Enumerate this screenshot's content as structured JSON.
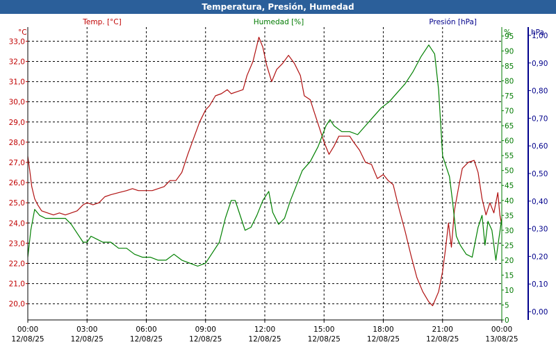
{
  "window_title": "Temperatura, Presión, Humedad",
  "chart_data": {
    "type": "line",
    "title": "Temperatura, Presión, Humedad",
    "grid": true,
    "x_labels": [
      {
        "time": "00:00",
        "date": "12/08/25"
      },
      {
        "time": "03:00",
        "date": "12/08/25"
      },
      {
        "time": "06:00",
        "date": "12/08/25"
      },
      {
        "time": "09:00",
        "date": "12/08/25"
      },
      {
        "time": "12:00",
        "date": "12/08/25"
      },
      {
        "time": "15:00",
        "date": "12/08/25"
      },
      {
        "time": "18:00",
        "date": "12/08/25"
      },
      {
        "time": "21:00",
        "date": "12/08/25"
      },
      {
        "time": "00:00",
        "date": "13/08/25"
      }
    ],
    "x_range_hours": [
      0,
      24
    ],
    "axes": {
      "temperature": {
        "label": "Temp. [°C]",
        "unit": "°C",
        "range": [
          19.2,
          33.7
        ],
        "ticks": [
          "20,0",
          "21,0",
          "22,0",
          "23,0",
          "24,0",
          "25,0",
          "26,0",
          "27,0",
          "28,0",
          "29,0",
          "30,0",
          "31,0",
          "32,0",
          "33,0"
        ],
        "tick_values": [
          20,
          21,
          22,
          23,
          24,
          25,
          26,
          27,
          28,
          29,
          30,
          31,
          32,
          33
        ],
        "color": "#c00000"
      },
      "humidity": {
        "label": "Humedad [%]",
        "unit": "%",
        "range": [
          0,
          98
        ],
        "ticks": [
          "0",
          "5",
          "10",
          "15",
          "20",
          "25",
          "30",
          "35",
          "40",
          "45",
          "50",
          "55",
          "60",
          "65",
          "70",
          "75",
          "80",
          "85",
          "90",
          "95"
        ],
        "tick_values": [
          0,
          5,
          10,
          15,
          20,
          25,
          30,
          35,
          40,
          45,
          50,
          55,
          60,
          65,
          70,
          75,
          80,
          85,
          90,
          95
        ],
        "color": "#007a00"
      },
      "pressure": {
        "label": "Presión [hPa]",
        "unit": "hPa",
        "range": [
          -0.03,
          1.03
        ],
        "ticks": [
          "0,00",
          "0,10",
          "0,20",
          "0,30",
          "0,40",
          "0,50",
          "0,60",
          "0,70",
          "0,80",
          "0,90",
          "1,00"
        ],
        "tick_values": [
          0,
          0.1,
          0.2,
          0.3,
          0.4,
          0.5,
          0.6,
          0.7,
          0.8,
          0.9,
          1.0
        ],
        "color": "#00008b"
      }
    },
    "series": [
      {
        "name": "Temp. [°C]",
        "axis": "temperature",
        "color": "#b01010",
        "points": [
          [
            0,
            27.3
          ],
          [
            0.1,
            26.6
          ],
          [
            0.2,
            25.8
          ],
          [
            0.35,
            25.2
          ],
          [
            0.5,
            24.9
          ],
          [
            0.7,
            24.6
          ],
          [
            1.0,
            24.5
          ],
          [
            1.3,
            24.4
          ],
          [
            1.6,
            24.5
          ],
          [
            1.9,
            24.4
          ],
          [
            2.2,
            24.5
          ],
          [
            2.5,
            24.6
          ],
          [
            2.8,
            24.9
          ],
          [
            3.0,
            25.0
          ],
          [
            3.3,
            24.9
          ],
          [
            3.6,
            25.0
          ],
          [
            3.9,
            25.3
          ],
          [
            4.2,
            25.4
          ],
          [
            4.6,
            25.5
          ],
          [
            5.0,
            25.6
          ],
          [
            5.3,
            25.7
          ],
          [
            5.6,
            25.6
          ],
          [
            6.0,
            25.6
          ],
          [
            6.3,
            25.6
          ],
          [
            6.6,
            25.7
          ],
          [
            6.9,
            25.8
          ],
          [
            7.2,
            26.1
          ],
          [
            7.5,
            26.1
          ],
          [
            7.8,
            26.5
          ],
          [
            8.1,
            27.4
          ],
          [
            8.4,
            28.2
          ],
          [
            8.7,
            29.0
          ],
          [
            9.0,
            29.6
          ],
          [
            9.2,
            29.8
          ],
          [
            9.5,
            30.3
          ],
          [
            9.8,
            30.4
          ],
          [
            10.1,
            30.6
          ],
          [
            10.3,
            30.4
          ],
          [
            10.6,
            30.5
          ],
          [
            10.9,
            30.6
          ],
          [
            11.1,
            31.3
          ],
          [
            11.4,
            32.0
          ],
          [
            11.7,
            33.2
          ],
          [
            11.9,
            32.7
          ],
          [
            12.1,
            31.8
          ],
          [
            12.35,
            31.0
          ],
          [
            12.6,
            31.6
          ],
          [
            12.9,
            31.9
          ],
          [
            13.2,
            32.3
          ],
          [
            13.5,
            31.9
          ],
          [
            13.8,
            31.3
          ],
          [
            14.0,
            30.3
          ],
          [
            14.3,
            30.1
          ],
          [
            14.5,
            29.5
          ],
          [
            14.8,
            28.6
          ],
          [
            15.0,
            28.0
          ],
          [
            15.25,
            27.4
          ],
          [
            15.5,
            27.8
          ],
          [
            15.75,
            28.3
          ],
          [
            16.0,
            28.3
          ],
          [
            16.3,
            28.3
          ],
          [
            16.5,
            28.0
          ],
          [
            16.8,
            27.6
          ],
          [
            17.1,
            27.0
          ],
          [
            17.4,
            26.9
          ],
          [
            17.7,
            26.2
          ],
          [
            18.0,
            26.4
          ],
          [
            18.25,
            26.1
          ],
          [
            18.5,
            25.9
          ],
          [
            18.8,
            24.7
          ],
          [
            19.1,
            23.6
          ],
          [
            19.4,
            22.4
          ],
          [
            19.7,
            21.3
          ],
          [
            20.0,
            20.6
          ],
          [
            20.3,
            20.1
          ],
          [
            20.5,
            19.9
          ],
          [
            20.8,
            20.6
          ],
          [
            21.0,
            21.6
          ],
          [
            21.15,
            22.7
          ],
          [
            21.3,
            24.0
          ],
          [
            21.45,
            22.8
          ],
          [
            21.6,
            24.6
          ],
          [
            21.8,
            25.7
          ],
          [
            22.0,
            26.7
          ],
          [
            22.3,
            27.0
          ],
          [
            22.6,
            27.1
          ],
          [
            22.8,
            26.5
          ],
          [
            23.0,
            25.2
          ],
          [
            23.2,
            24.4
          ],
          [
            23.4,
            25.0
          ],
          [
            23.6,
            24.5
          ],
          [
            23.8,
            25.5
          ],
          [
            23.9,
            24.4
          ],
          [
            24.0,
            23.9
          ]
        ]
      },
      {
        "name": "Humedad [%]",
        "axis": "humidity",
        "color": "#008000",
        "points": [
          [
            0,
            21
          ],
          [
            0.15,
            30
          ],
          [
            0.35,
            37
          ],
          [
            0.6,
            35
          ],
          [
            0.9,
            34
          ],
          [
            1.2,
            34
          ],
          [
            1.5,
            34
          ],
          [
            1.9,
            34
          ],
          [
            2.2,
            32
          ],
          [
            2.5,
            29
          ],
          [
            2.8,
            26
          ],
          [
            3.0,
            26
          ],
          [
            3.2,
            28
          ],
          [
            3.5,
            27
          ],
          [
            3.8,
            26
          ],
          [
            4.2,
            26
          ],
          [
            4.6,
            24
          ],
          [
            5.0,
            24
          ],
          [
            5.4,
            22
          ],
          [
            5.8,
            21
          ],
          [
            6.2,
            21
          ],
          [
            6.6,
            20
          ],
          [
            7.0,
            20
          ],
          [
            7.4,
            22
          ],
          [
            7.8,
            20
          ],
          [
            8.2,
            19
          ],
          [
            8.6,
            18
          ],
          [
            9.0,
            19
          ],
          [
            9.3,
            22
          ],
          [
            9.7,
            26
          ],
          [
            10.0,
            34
          ],
          [
            10.3,
            40
          ],
          [
            10.5,
            40
          ],
          [
            10.7,
            36
          ],
          [
            11.0,
            30
          ],
          [
            11.3,
            31
          ],
          [
            11.6,
            35
          ],
          [
            11.9,
            40
          ],
          [
            12.2,
            43
          ],
          [
            12.4,
            36
          ],
          [
            12.7,
            32
          ],
          [
            13.0,
            34
          ],
          [
            13.3,
            40
          ],
          [
            13.6,
            45
          ],
          [
            13.9,
            50
          ],
          [
            14.3,
            53
          ],
          [
            14.7,
            58
          ],
          [
            15.1,
            65
          ],
          [
            15.3,
            67
          ],
          [
            15.5,
            65
          ],
          [
            15.9,
            63
          ],
          [
            16.3,
            63
          ],
          [
            16.7,
            62
          ],
          [
            17.1,
            65
          ],
          [
            17.5,
            68
          ],
          [
            17.9,
            71
          ],
          [
            18.3,
            73
          ],
          [
            18.7,
            76
          ],
          [
            19.1,
            79
          ],
          [
            19.5,
            83
          ],
          [
            19.9,
            88
          ],
          [
            20.3,
            92
          ],
          [
            20.6,
            89
          ],
          [
            20.8,
            77
          ],
          [
            21.0,
            55
          ],
          [
            21.2,
            51
          ],
          [
            21.35,
            48
          ],
          [
            21.5,
            40
          ],
          [
            21.7,
            28
          ],
          [
            21.9,
            25
          ],
          [
            22.2,
            22
          ],
          [
            22.5,
            21
          ],
          [
            22.8,
            31
          ],
          [
            23.0,
            35
          ],
          [
            23.15,
            25
          ],
          [
            23.3,
            33
          ],
          [
            23.5,
            30
          ],
          [
            23.7,
            20
          ],
          [
            23.85,
            27
          ],
          [
            24.0,
            34
          ]
        ]
      }
    ]
  }
}
